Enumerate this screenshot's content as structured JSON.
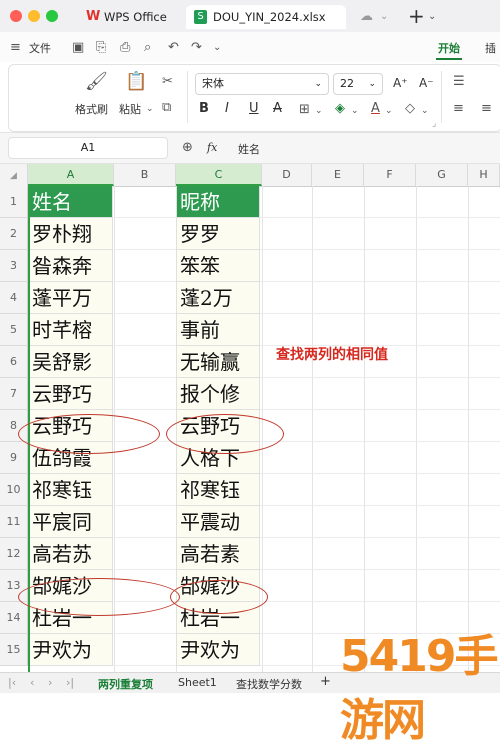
{
  "titlebar": {
    "tab1": "WPS Office",
    "tab2": "DOU_YIN_2024.xlsx",
    "new_tab": "+",
    "colors": {
      "close": "#ff5f57",
      "min": "#febc2e",
      "max": "#28c840",
      "wps": "#e0312b",
      "xlsx": "#1f9d55"
    }
  },
  "menu": {
    "file": "文件",
    "start": "开始",
    "insert": "插"
  },
  "ribbon": {
    "format_painter": "格式刷",
    "paste": "粘贴",
    "font_name": "宋体",
    "font_size": "22",
    "bold": "B",
    "italic": "I",
    "underline": "U",
    "strike": "A",
    "font_grow": "A⁺",
    "font_shrink": "A⁻"
  },
  "formula_bar": {
    "cell_ref": "A1",
    "fx": "fx",
    "content": "姓名"
  },
  "columns": [
    "A",
    "B",
    "C",
    "D",
    "E",
    "F",
    "G",
    "H"
  ],
  "rows": [
    "1",
    "2",
    "3",
    "4",
    "5",
    "6",
    "7",
    "8",
    "9",
    "10",
    "11",
    "12",
    "13",
    "14",
    "15"
  ],
  "col_a": [
    "姓名",
    "罗朴翔",
    "昝森奔",
    "蓬平万",
    "时芊榕",
    "吴舒影",
    "云野巧",
    "云野巧",
    "伍鸽霞",
    "祁寒钰",
    "平宸同",
    "高若苏",
    "郜娓沙",
    "杜岩一",
    "尹欢为"
  ],
  "col_c": [
    "昵称",
    "罗罗",
    "笨笨",
    "蓬2万",
    "事前",
    "无输赢",
    "报个修",
    "云野巧",
    "人格下",
    "祁寒钰",
    "平震动",
    "高若素",
    "郜娓沙",
    "杜岩一",
    "尹欢为"
  ],
  "annotation": "查找两列的相同值",
  "sheets": {
    "tab1": "两列重复项",
    "tab2": "Sheet1",
    "tab3": "查找数学分数",
    "add": "+"
  },
  "watermark": "5419手游网"
}
